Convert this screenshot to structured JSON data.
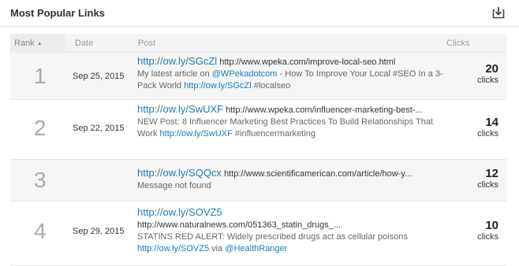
{
  "panel": {
    "title": "Most Popular Links"
  },
  "table": {
    "columns": {
      "rank": "Rank",
      "date": "Date",
      "post": "Post",
      "clicks": "Clicks"
    },
    "sort_arrow": "▲",
    "rows": [
      {
        "rank": "1",
        "date": "Sep 25, 2015",
        "short_link": "http://ow.ly/SGcZl",
        "long_url": "http://www.wpeka.com/improve-local-seo.html",
        "desc_pre": "My latest article on ",
        "desc_handle": "@WPekadotcom",
        "desc_mid": " - How To Improve Your Local #SEO In a 3-Pack World ",
        "desc_link": "http://ow.ly/SGcZl",
        "desc_post": " #localseo",
        "clicks": "20",
        "clicks_label": "clicks"
      },
      {
        "rank": "2",
        "date": "Sep 22, 2015",
        "short_link": "http://ow.ly/SwUXF",
        "long_url": "http://www.wpeka.com/influencer-marketing-best-...",
        "desc_pre": "NEW Post: 8 Influencer Marketing Best Practices To Build Relationships That Work ",
        "desc_link": "http://ow.ly/SwUXF",
        "desc_post": " #influencermarketing",
        "clicks": "14",
        "clicks_label": "clicks"
      },
      {
        "rank": "3",
        "date": "",
        "short_link": "http://ow.ly/SQQcx",
        "long_url": "http://www.scientificamerican.com/article/how-y...",
        "desc": "Message not found",
        "clicks": "12",
        "clicks_label": "clicks"
      },
      {
        "rank": "4",
        "date": "Sep 29, 2015",
        "short_link": "http://ow.ly/SOVZ5",
        "long_url": "http://www.naturalnews.com/051363_statin_drugs_...",
        "desc_pre": "STATINS RED ALERT: Widely prescribed drugs act as cellular poisons ",
        "desc_link": "http://ow.ly/SOVZ5",
        "desc_mid": " via ",
        "desc_handle": "@HealthRanger",
        "clicks": "10",
        "clicks_label": "clicks"
      }
    ]
  },
  "colors": {
    "link": "#1a7bb9",
    "row_alt": "#f6f6f6",
    "header_bg": "#f4f4f4"
  },
  "icons": {
    "export": "download-box-icon",
    "sort": "sort-asc-icon"
  }
}
